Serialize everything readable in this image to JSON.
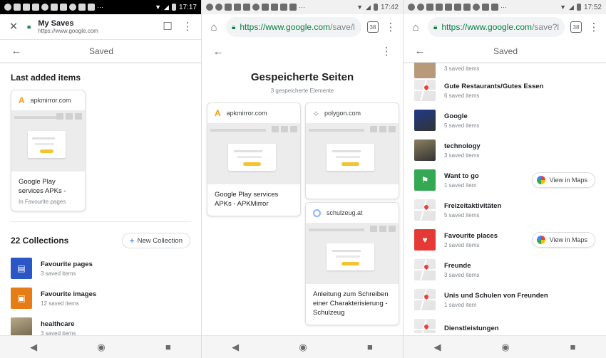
{
  "screen1": {
    "status": {
      "time": "17:17"
    },
    "header": {
      "title": "My Saves",
      "url": "https://www.google.com"
    },
    "subheader": {
      "title": "Saved"
    },
    "last_added": {
      "heading": "Last added items",
      "card": {
        "site": "apkmirror.com",
        "title": "Google Play services APKs -",
        "sub": "In Favourite pages"
      }
    },
    "collections": {
      "heading": "22 Collections",
      "new_button": "New Collection",
      "items": [
        {
          "title": "Favourite pages",
          "sub": "3 saved items",
          "color": "#2a56c6",
          "icon": "bookmark-icon"
        },
        {
          "title": "Favourite images",
          "sub": "12 saved items",
          "color": "#e67c15",
          "icon": "image-icon"
        },
        {
          "title": "healthcare",
          "sub": "3 saved items",
          "color": "#8a7f6a",
          "icon": "photo"
        }
      ]
    }
  },
  "screen2": {
    "status": {
      "time": "17:42"
    },
    "url": {
      "green": "https://www.google.com",
      "gray": "/save/l"
    },
    "tab_count": "38",
    "heading": "Gespeicherte Seiten",
    "sub": "3 gespeicherte Elemente",
    "cards": [
      {
        "site": "apkmirror.com",
        "title": "Google Play services APKs - APKMirror"
      },
      {
        "site": "polygon.com",
        "title": ""
      },
      {
        "site": "schulzeug.at",
        "title": "Anleitung zum Schreiben einer Charakterisierung - Schulzeug"
      }
    ]
  },
  "screen3": {
    "status": {
      "time": "17:52"
    },
    "url": {
      "green": "https://www.google.com",
      "gray": "/save?l"
    },
    "tab_count": "38",
    "subheader": {
      "title": "Saved"
    },
    "top_partial": "3 saved items",
    "maps_label": "View in Maps",
    "items": [
      {
        "title": "Gute Restaurants/Gutes Essen",
        "sub": "6 saved items",
        "kind": "map",
        "maps": false
      },
      {
        "title": "Google",
        "sub": "5 saved items",
        "kind": "photo",
        "color": "#1e3a8a",
        "maps": false
      },
      {
        "title": "technology",
        "sub": "3 saved items",
        "kind": "photo",
        "color": "#8a8060",
        "maps": false
      },
      {
        "title": "Want to go",
        "sub": "1 saved item",
        "kind": "flag",
        "color": "#34a853",
        "maps": true
      },
      {
        "title": "Freizeitaktivitäten",
        "sub": "5 saved items",
        "kind": "map",
        "maps": false
      },
      {
        "title": "Favourite places",
        "sub": "2 saved items",
        "kind": "heart",
        "color": "#e53935",
        "maps": true
      },
      {
        "title": "Freunde",
        "sub": "3 saved items",
        "kind": "map",
        "maps": false
      },
      {
        "title": "Unis und Schulen von Freunden",
        "sub": "1 saved item",
        "kind": "map",
        "maps": false
      },
      {
        "title": "Dienstleistungen",
        "sub": "",
        "kind": "map",
        "maps": false
      }
    ]
  }
}
